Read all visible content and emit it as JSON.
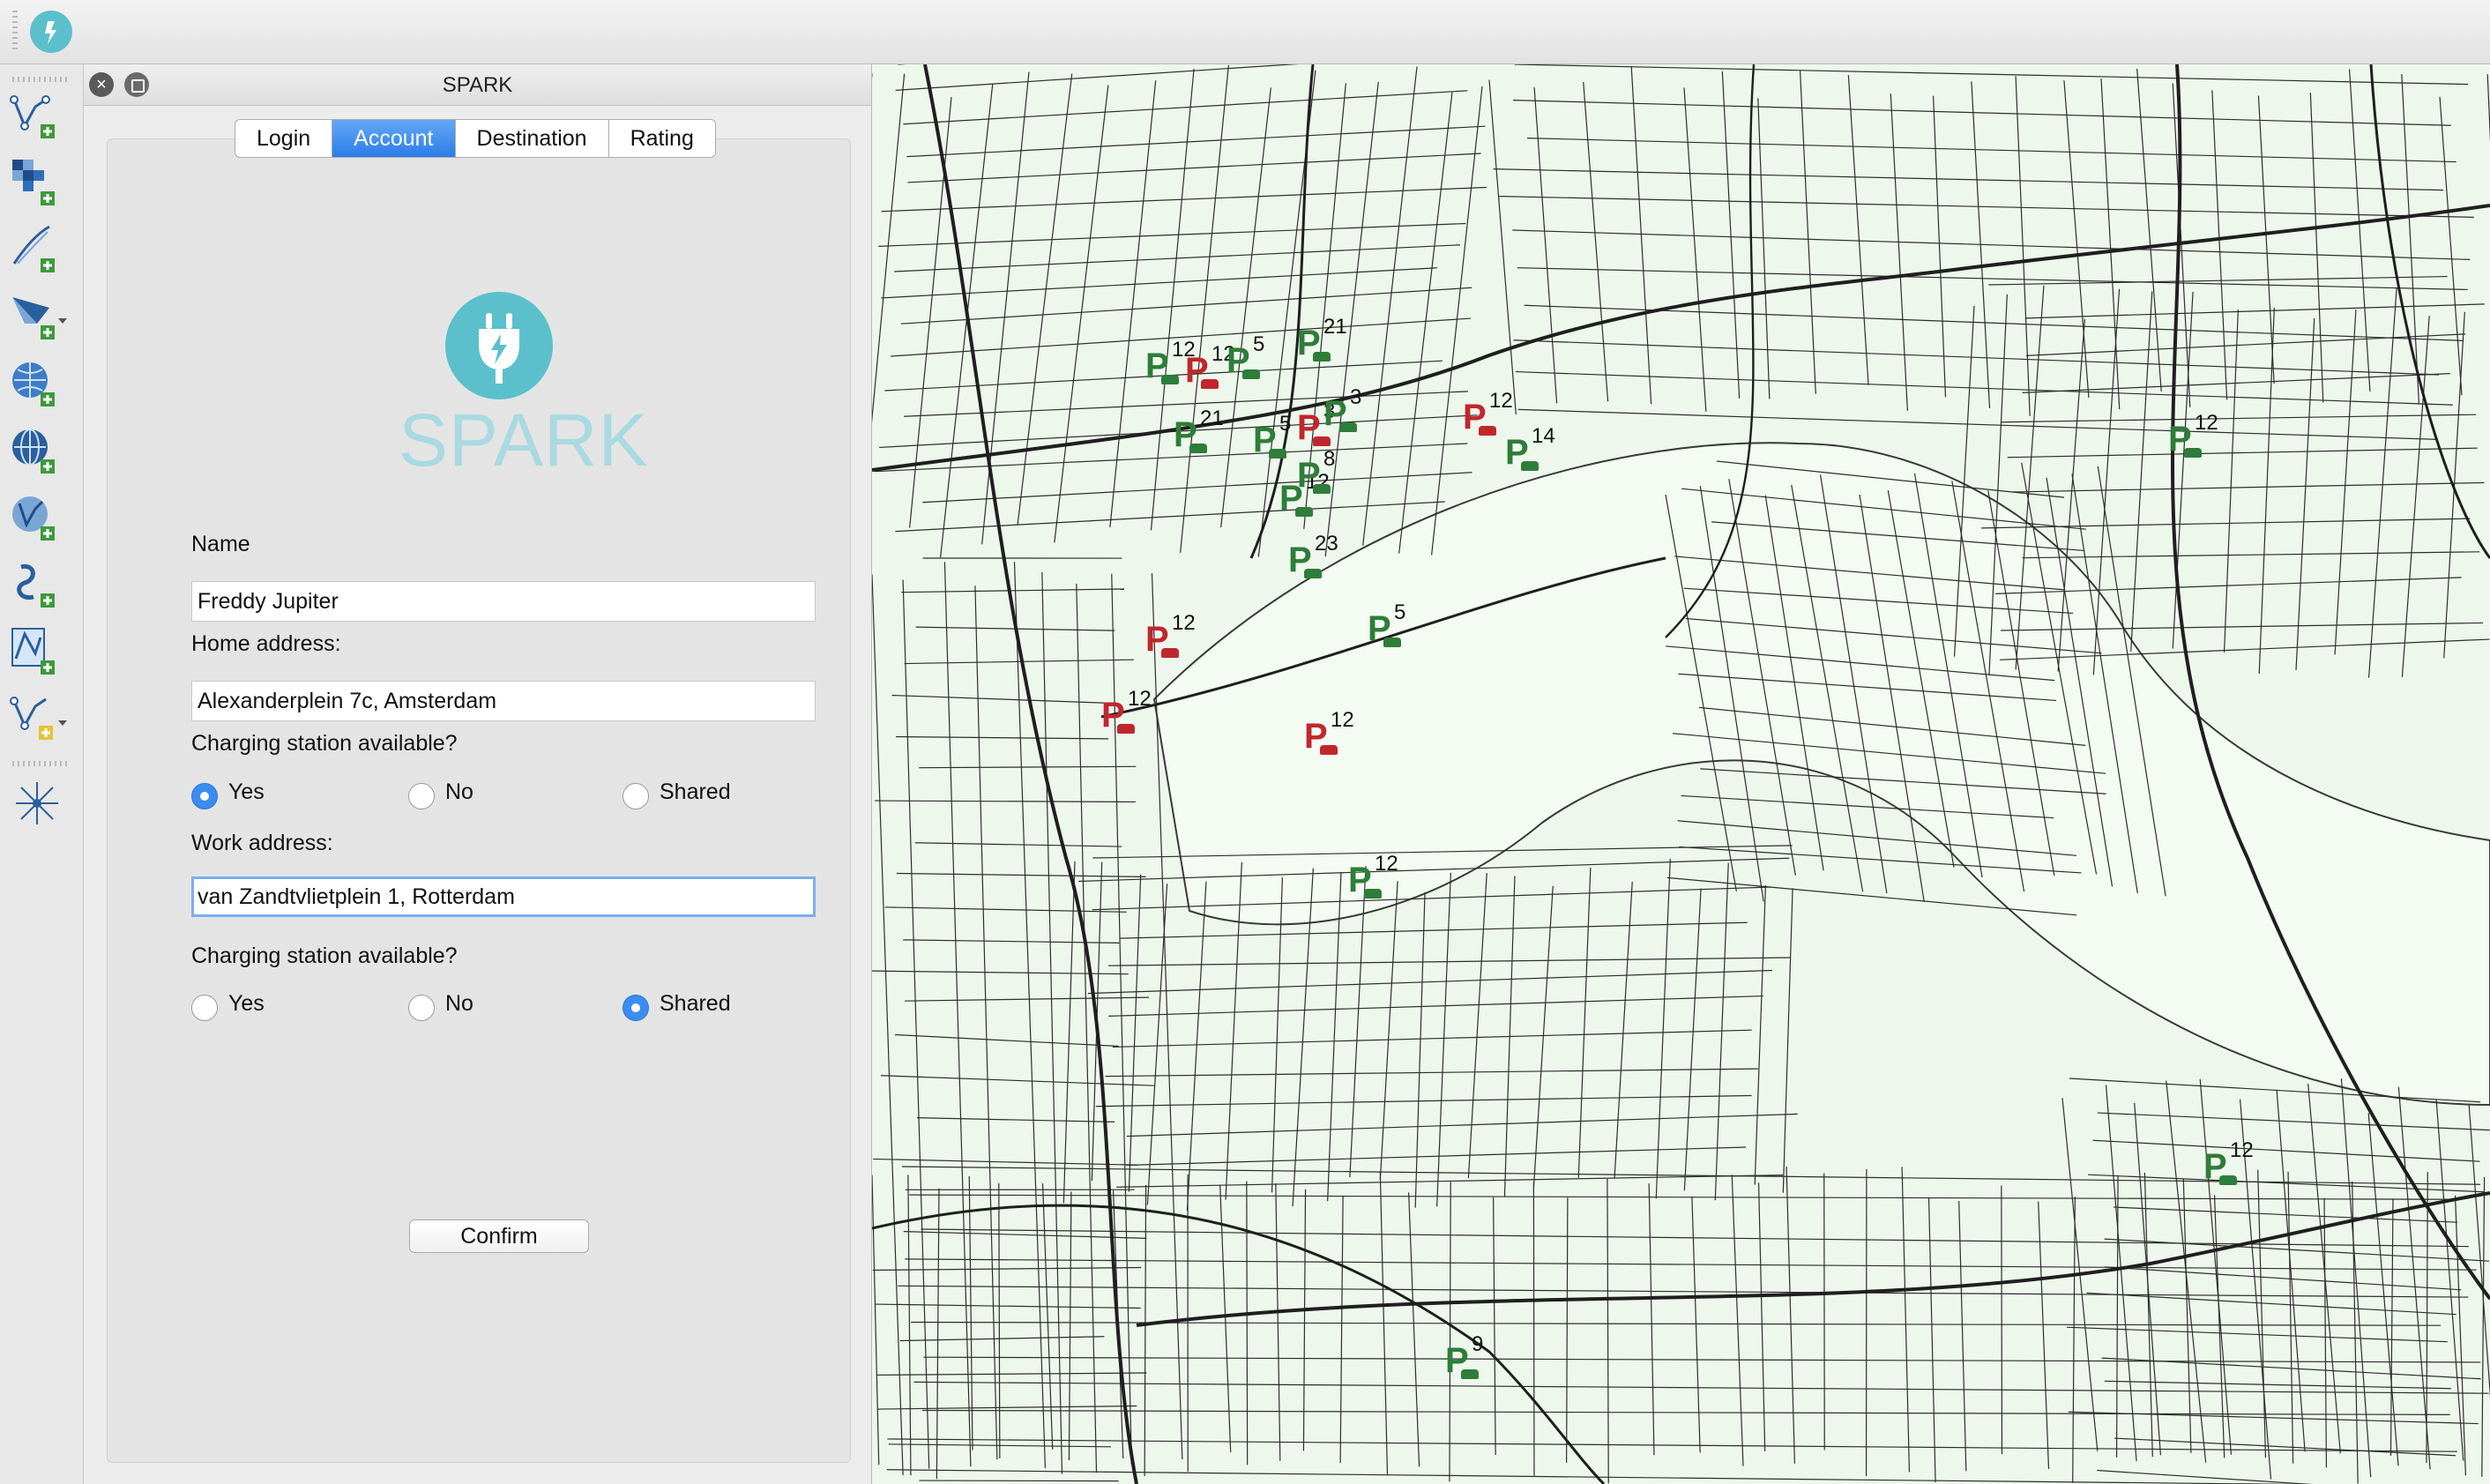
{
  "panel": {
    "title": "SPARK",
    "close_glyph": "×",
    "tabs": [
      {
        "label": "Login",
        "active": false
      },
      {
        "label": "Account",
        "active": true
      },
      {
        "label": "Destination",
        "active": false
      },
      {
        "label": "Rating",
        "active": false
      }
    ],
    "logo": {
      "text": "SPARK",
      "icon": "plug-bolt-icon",
      "color": "#5bc0cc"
    },
    "form": {
      "name_label": "Name",
      "name_value": "Freddy Jupiter",
      "home_label": "Home address:",
      "home_value": "Alexanderplein 7c, Amsterdam",
      "home_charging_label": "Charging station available?",
      "home_options": [
        "Yes",
        "No",
        "Shared"
      ],
      "home_selected": "Yes",
      "work_label": "Work address:",
      "work_value": "van Zandtvlietplein 1, Rotterdam",
      "work_charging_label": "Charging station available?",
      "work_options": [
        "Yes",
        "No",
        "Shared"
      ],
      "work_selected": "Shared",
      "confirm_label": "Confirm"
    }
  },
  "toolbar": {
    "tools": [
      "add-vector-layer-icon",
      "add-raster-layer-icon",
      "add-delimited-text-icon",
      "add-spatialite-layer-icon",
      "add-wms-layer-icon",
      "add-wfs-layer-icon",
      "add-postgis-layer-icon",
      "add-mssql-layer-icon",
      "add-oracle-layer-icon",
      "new-shapefile-icon",
      "gps-tool-icon"
    ]
  },
  "map": {
    "background": "#eef7ec",
    "available_color": "#2e7d3a",
    "occupied_color": "#c0272d",
    "markers": [
      {
        "label": "12",
        "status": "available"
      },
      {
        "label": "12",
        "status": "occupied"
      },
      {
        "label": "5",
        "status": "available"
      },
      {
        "label": "21",
        "status": "available"
      },
      {
        "label": "21",
        "status": "available"
      },
      {
        "label": "5",
        "status": "available"
      },
      {
        "label": "3",
        "status": "occupied"
      },
      {
        "label": "3",
        "status": "available"
      },
      {
        "label": "12",
        "status": "available"
      },
      {
        "label": "8",
        "status": "available"
      },
      {
        "label": "23",
        "status": "available"
      },
      {
        "label": "12",
        "status": "occupied"
      },
      {
        "label": "14",
        "status": "available"
      },
      {
        "label": "5",
        "status": "available"
      },
      {
        "label": "12",
        "status": "occupied"
      },
      {
        "label": "12",
        "status": "occupied"
      },
      {
        "label": "12",
        "status": "occupied"
      },
      {
        "label": "12",
        "status": "available"
      },
      {
        "label": "12",
        "status": "available"
      },
      {
        "label": "12",
        "status": "available"
      },
      {
        "label": "9",
        "status": "available"
      }
    ]
  }
}
